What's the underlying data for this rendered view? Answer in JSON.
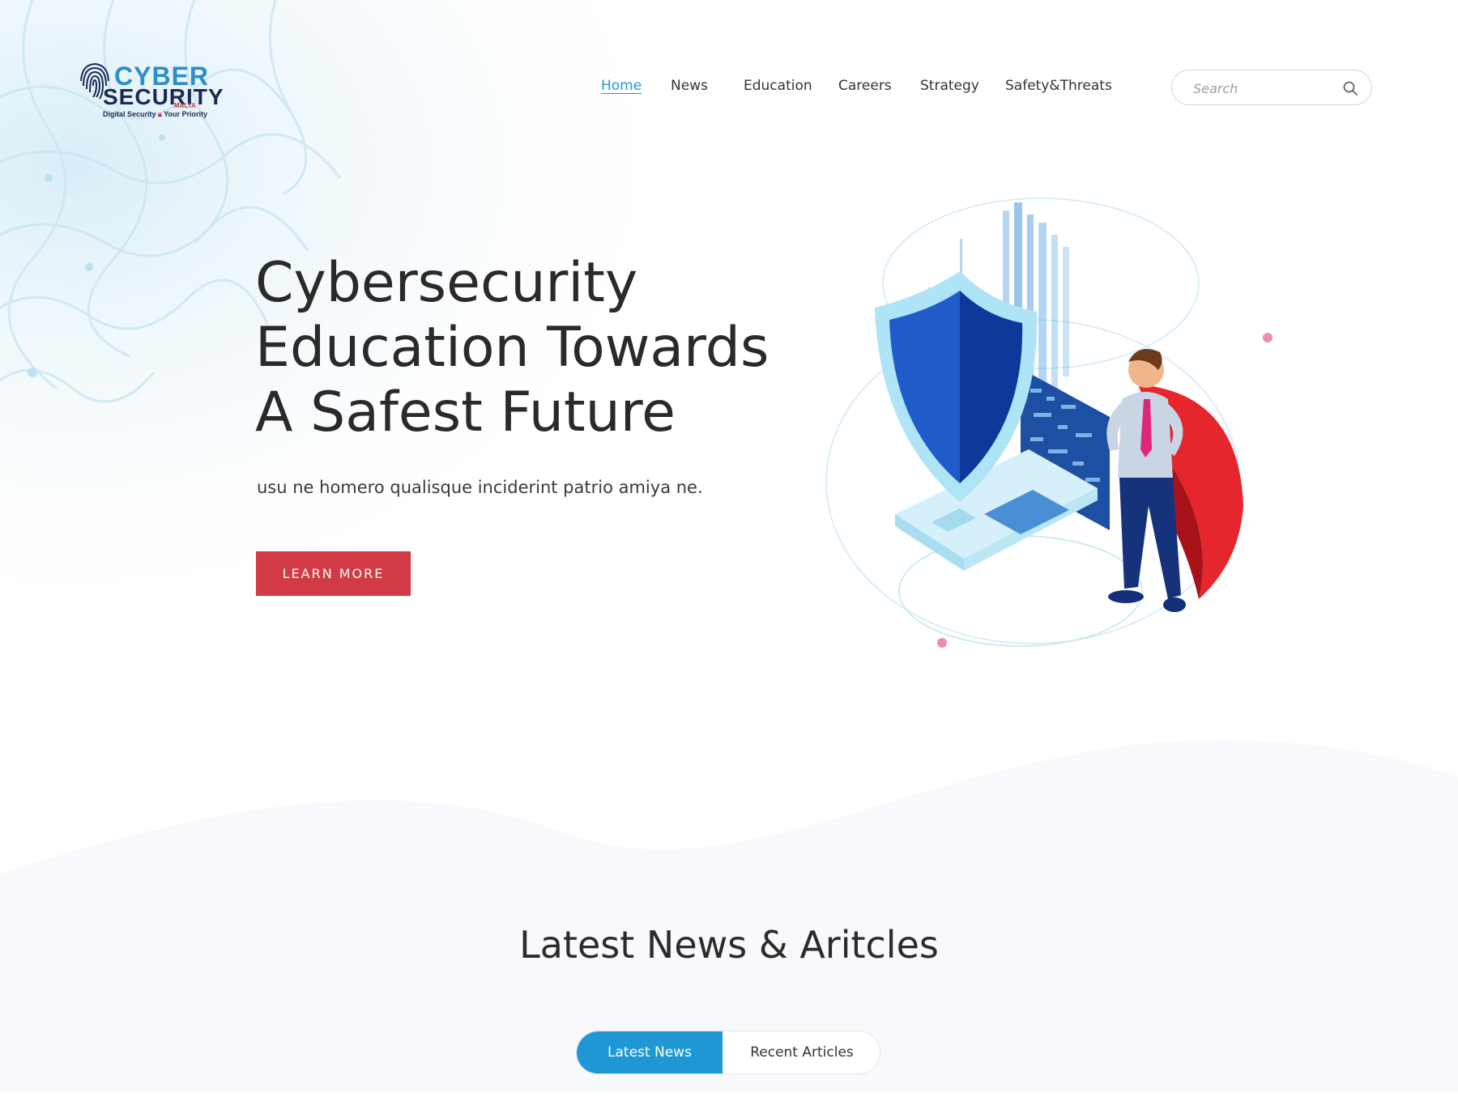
{
  "logo": {
    "word1": "CYBER",
    "word2": "SECURITY",
    "word3": "MALTA",
    "tagline_left": "Digital Security",
    "tagline_right": "Your Priority"
  },
  "nav": {
    "items": [
      {
        "label": "Home",
        "active": true
      },
      {
        "label": "News",
        "active": false
      },
      {
        "label": "Education",
        "active": false
      },
      {
        "label": "Careers",
        "active": false
      },
      {
        "label": "Strategy",
        "active": false
      },
      {
        "label": "Safety&Threats",
        "active": false
      }
    ]
  },
  "search": {
    "placeholder": "Search",
    "icon": "search-icon"
  },
  "hero": {
    "title_lines": [
      "Cybersecurity",
      "Education Towards",
      "A Safest Future"
    ],
    "subtitle": "usu ne homero qualisque inciderint patrio amiya ne.",
    "cta_label": "LEARN MORE"
  },
  "section": {
    "title": "Latest News & Aritcles",
    "tabs": [
      {
        "label": "Latest News",
        "active": true
      },
      {
        "label": "Recent Articles",
        "active": false
      }
    ]
  },
  "colors": {
    "accent": "#1f97d4",
    "cta": "#d23b45",
    "text": "#2b2b2b",
    "logo_blue": "#2a8fcb",
    "logo_navy": "#1b2a55"
  }
}
